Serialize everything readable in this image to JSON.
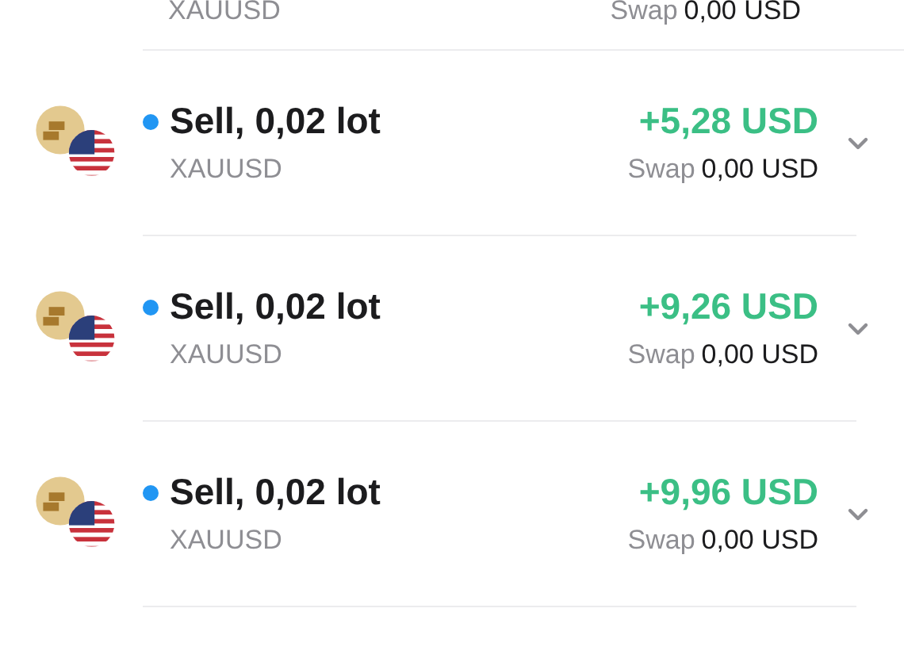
{
  "top_row": {
    "symbol": "XAUUSD",
    "swap_label": "Swap",
    "swap_value": "0,00 USD"
  },
  "positions": [
    {
      "title": "Sell, 0,02 lot",
      "symbol": "XAUUSD",
      "profit": "+5,28 USD",
      "swap_label": "Swap",
      "swap_value": "0,00 USD",
      "expanded": false
    },
    {
      "title": "Sell, 0,02 lot",
      "symbol": "XAUUSD",
      "profit": "+9,26 USD",
      "swap_label": "Swap",
      "swap_value": "0,00 USD",
      "expanded": false
    },
    {
      "title": "Sell, 0,02 lot",
      "symbol": "XAUUSD",
      "profit": "+9,96 USD",
      "swap_label": "Swap",
      "swap_value": "0,00 USD",
      "expanded": false
    }
  ]
}
